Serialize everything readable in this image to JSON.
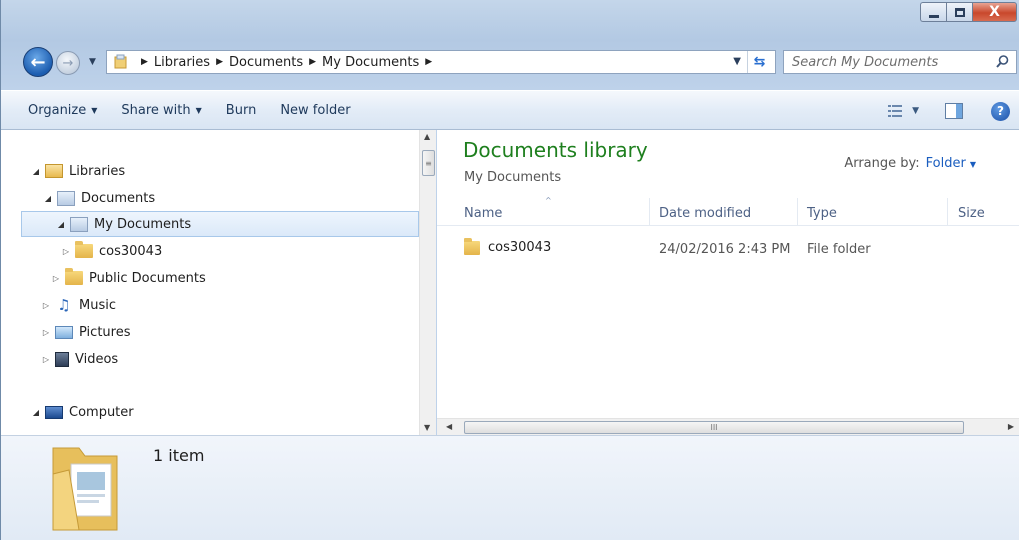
{
  "window": {
    "caption": {
      "minimize": "",
      "maximize": "",
      "close": "X"
    }
  },
  "address_bar": {
    "crumbs": [
      "Libraries",
      "Documents",
      "My Documents"
    ]
  },
  "search": {
    "placeholder": "Search My Documents"
  },
  "toolbar": {
    "organize": "Organize",
    "share_with": "Share with",
    "burn": "Burn",
    "new_folder": "New folder"
  },
  "nav_tree": {
    "libraries": "Libraries",
    "documents": "Documents",
    "my_documents": "My Documents",
    "cos30043": "cos30043",
    "public_documents": "Public Documents",
    "music": "Music",
    "pictures": "Pictures",
    "videos": "Videos",
    "computer": "Computer"
  },
  "content": {
    "title": "Documents library",
    "subtitle": "My Documents",
    "arrange_label": "Arrange by:",
    "arrange_value": "Folder",
    "columns": {
      "name": "Name",
      "date_modified": "Date modified",
      "type": "Type",
      "size": "Size"
    },
    "rows": [
      {
        "name": "cos30043",
        "date_modified": "24/02/2016 2:43 PM",
        "type": "File folder",
        "size": ""
      }
    ]
  },
  "details": {
    "count": "1 item"
  },
  "icons": {
    "back": "back-arrow-icon",
    "forward": "forward-arrow-icon",
    "refresh": "refresh-icon",
    "search": "search-icon",
    "help": "help-icon"
  }
}
